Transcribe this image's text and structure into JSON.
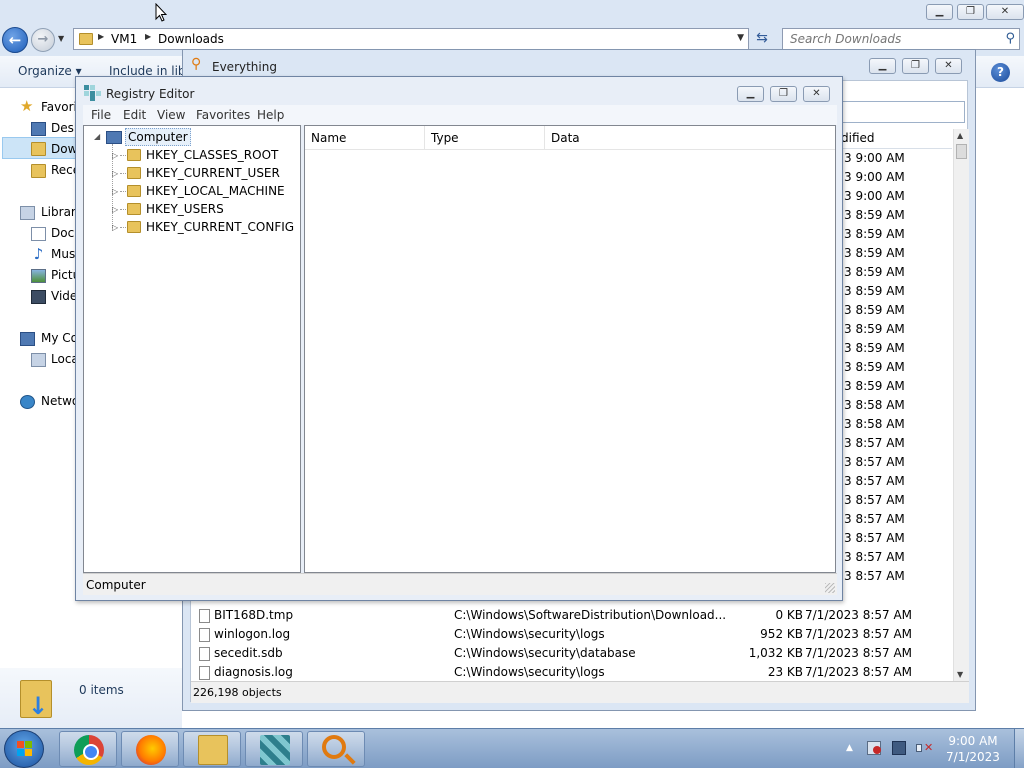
{
  "explorer": {
    "address_crumbs": [
      "VM1",
      "Downloads"
    ],
    "search_placeholder": "Search Downloads",
    "toolbar": {
      "organize": "Organize ▾",
      "include": "Include in libr"
    },
    "nav": {
      "favorites": "Favorit",
      "desktop": "Desk",
      "downloads": "Dow",
      "recent": "Rece",
      "libraries": "Librari",
      "documents": "Docu",
      "music": "Mus",
      "pictures": "Pictu",
      "videos": "Vide",
      "computer": "My Co",
      "local_disk": "Loca",
      "network": "Netwo"
    },
    "details": {
      "count": "0 items"
    }
  },
  "everything": {
    "title": "Everything",
    "column_modified": "dified",
    "partial_dates": [
      "3 9:00 AM",
      "3 9:00 AM",
      "3 9:00 AM",
      "3 8:59 AM",
      "3 8:59 AM",
      "3 8:59 AM",
      "3 8:59 AM",
      "3 8:59 AM",
      "3 8:59 AM",
      "3 8:59 AM",
      "3 8:59 AM",
      "3 8:59 AM",
      "3 8:59 AM",
      "3 8:58 AM",
      "3 8:58 AM",
      "3 8:57 AM",
      "3 8:57 AM",
      "3 8:57 AM",
      "3 8:57 AM",
      "3 8:57 AM",
      "3 8:57 AM",
      "3 8:57 AM",
      "3 8:57 AM"
    ],
    "files": [
      {
        "name": "BIT168D.tmp",
        "path": "C:\\Windows\\SoftwareDistribution\\Download...",
        "size": "0 KB",
        "date": "7/1/2023 8:57 AM"
      },
      {
        "name": "winlogon.log",
        "path": "C:\\Windows\\security\\logs",
        "size": "952 KB",
        "date": "7/1/2023 8:57 AM"
      },
      {
        "name": "secedit.sdb",
        "path": "C:\\Windows\\security\\database",
        "size": "1,032 KB",
        "date": "7/1/2023 8:57 AM"
      },
      {
        "name": "diagnosis.log",
        "path": "C:\\Windows\\security\\logs",
        "size": "23 KB",
        "date": "7/1/2023 8:57 AM"
      }
    ],
    "status": "226,198 objects"
  },
  "regedit": {
    "title": "Registry Editor",
    "menu": [
      "File",
      "Edit",
      "View",
      "Favorites",
      "Help"
    ],
    "tree_root": "Computer",
    "hives": [
      "HKEY_CLASSES_ROOT",
      "HKEY_CURRENT_USER",
      "HKEY_LOCAL_MACHINE",
      "HKEY_USERS",
      "HKEY_CURRENT_CONFIG"
    ],
    "columns": [
      "Name",
      "Type",
      "Data"
    ],
    "status": "Computer"
  },
  "taskbar": {
    "clock_time": "9:00 AM",
    "clock_date": "7/1/2023",
    "pinned_icons": [
      "chrome-icon",
      "firefox-icon",
      "explorer-icon",
      "regedit-icon",
      "everything-icon"
    ]
  },
  "colors": {
    "title_blue": "#dbe6f4",
    "taskbar_top": "#a9c0dc",
    "taskbar_bottom": "#7d9cc4",
    "selection": "#cce4f7"
  }
}
